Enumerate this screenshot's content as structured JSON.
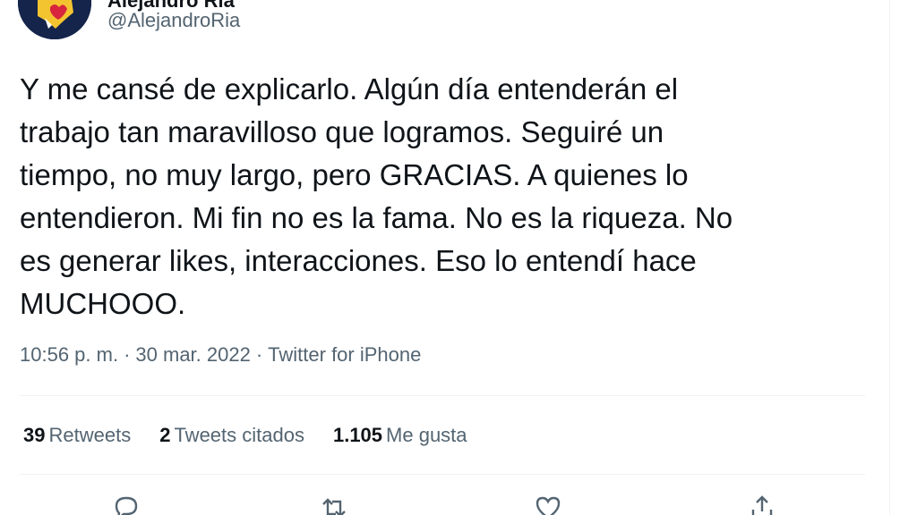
{
  "author": {
    "display_name": "Alejandro Ria",
    "handle": "@AlejandroRia"
  },
  "tweet": {
    "text": "Y me cansé de explicarlo. Algún día entenderán el\ntrabajo tan maravilloso que logramos. Seguiré un\ntiempo, no muy largo, pero GRACIAS. A quienes lo\nentendieron. Mi fin no es la fama. No es la riqueza. No\nes generar likes, interacciones. Eso lo entendí hace\nMUCHOOO.",
    "time": "10:56 p. m.",
    "separator": "·",
    "date": "30 mar. 2022",
    "source": "Twitter for iPhone"
  },
  "stats": {
    "retweets_count": "39",
    "retweets_label": "Retweets",
    "quotes_count": "2",
    "quotes_label": "Tweets citados",
    "likes_count": "1.105",
    "likes_label": "Me gusta"
  },
  "actions": {
    "reply_icon": "reply-icon",
    "retweet_icon": "retweet-icon",
    "like_icon": "heart-icon",
    "share_icon": "share-icon"
  },
  "colors": {
    "text_primary": "#0f1419",
    "text_secondary": "#536471",
    "divider": "#eff3f4",
    "avatar_bg": "#15244a",
    "avatar_flag_yellow": "#f4c430",
    "avatar_heart_red": "#d7263d"
  }
}
